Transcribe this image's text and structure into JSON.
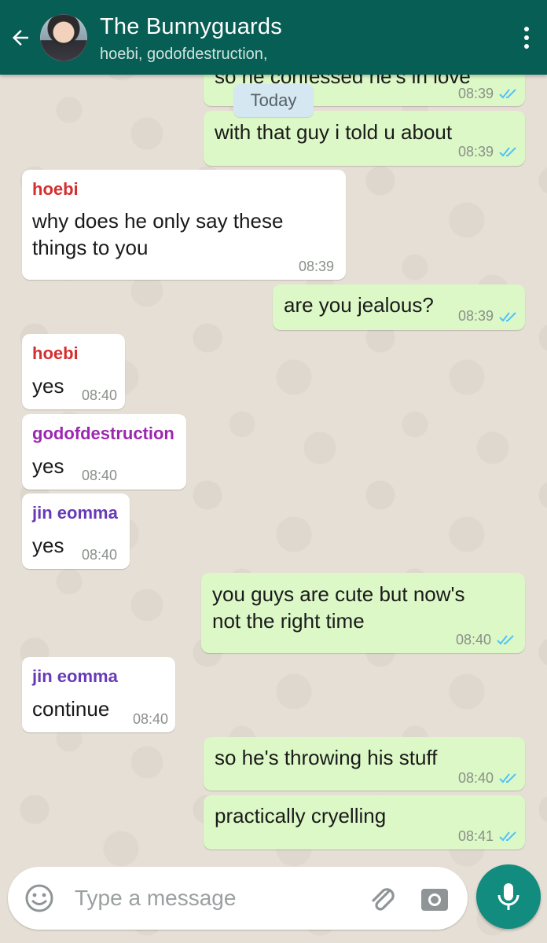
{
  "header": {
    "title": "The Bunnyguards",
    "subtitle": "hoebi, godofdestruction,"
  },
  "date_chip": "Today",
  "messages": [
    {
      "dir": "out",
      "text": "so he confessed he's in love",
      "time": "08:39",
      "ticks": "read"
    },
    {
      "dir": "out",
      "text": "with that guy i told u about",
      "time": "08:39",
      "ticks": "read"
    },
    {
      "dir": "in",
      "sender": "hoebi",
      "sender_color": "#d32f2f",
      "text": "why does he only say these\nthings to you",
      "time": "08:39"
    },
    {
      "dir": "out",
      "text": "are you jealous?",
      "time": "08:39",
      "ticks": "read"
    },
    {
      "dir": "in",
      "sender": "hoebi",
      "sender_color": "#d32f2f",
      "text": "yes",
      "time": "08:40"
    },
    {
      "dir": "in",
      "sender": "godofdestruction",
      "sender_color": "#9c27b0",
      "text": "yes",
      "time": "08:40"
    },
    {
      "dir": "in",
      "sender": "jin eomma",
      "sender_color": "#673ab7",
      "text": "yes",
      "time": "08:40"
    },
    {
      "dir": "out",
      "text": "you guys are cute but now's\nnot the right time",
      "time": "08:40",
      "ticks": "read"
    },
    {
      "dir": "in",
      "sender": "jin eomma",
      "sender_color": "#673ab7",
      "text": "continue",
      "time": "08:40"
    },
    {
      "dir": "out",
      "text": "so he's throwing his stuff",
      "time": "08:40",
      "ticks": "read"
    },
    {
      "dir": "out",
      "text": "practically cryelling",
      "time": "08:41",
      "ticks": "read"
    }
  ],
  "composer": {
    "placeholder": "Type a message"
  },
  "icons": {
    "back": "arrow-left-icon",
    "menu": "more-vert-icon",
    "emoji": "emoji-icon",
    "attach": "paperclip-icon",
    "camera": "camera-icon",
    "mic": "mic-icon",
    "read_ticks": "double-check-icon"
  },
  "colors": {
    "header": "#075e54",
    "outgoing_bubble": "#dcf8c6",
    "incoming_bubble": "#ffffff",
    "read_ticks": "#4fc3f7",
    "mic_button": "#128c7e"
  }
}
